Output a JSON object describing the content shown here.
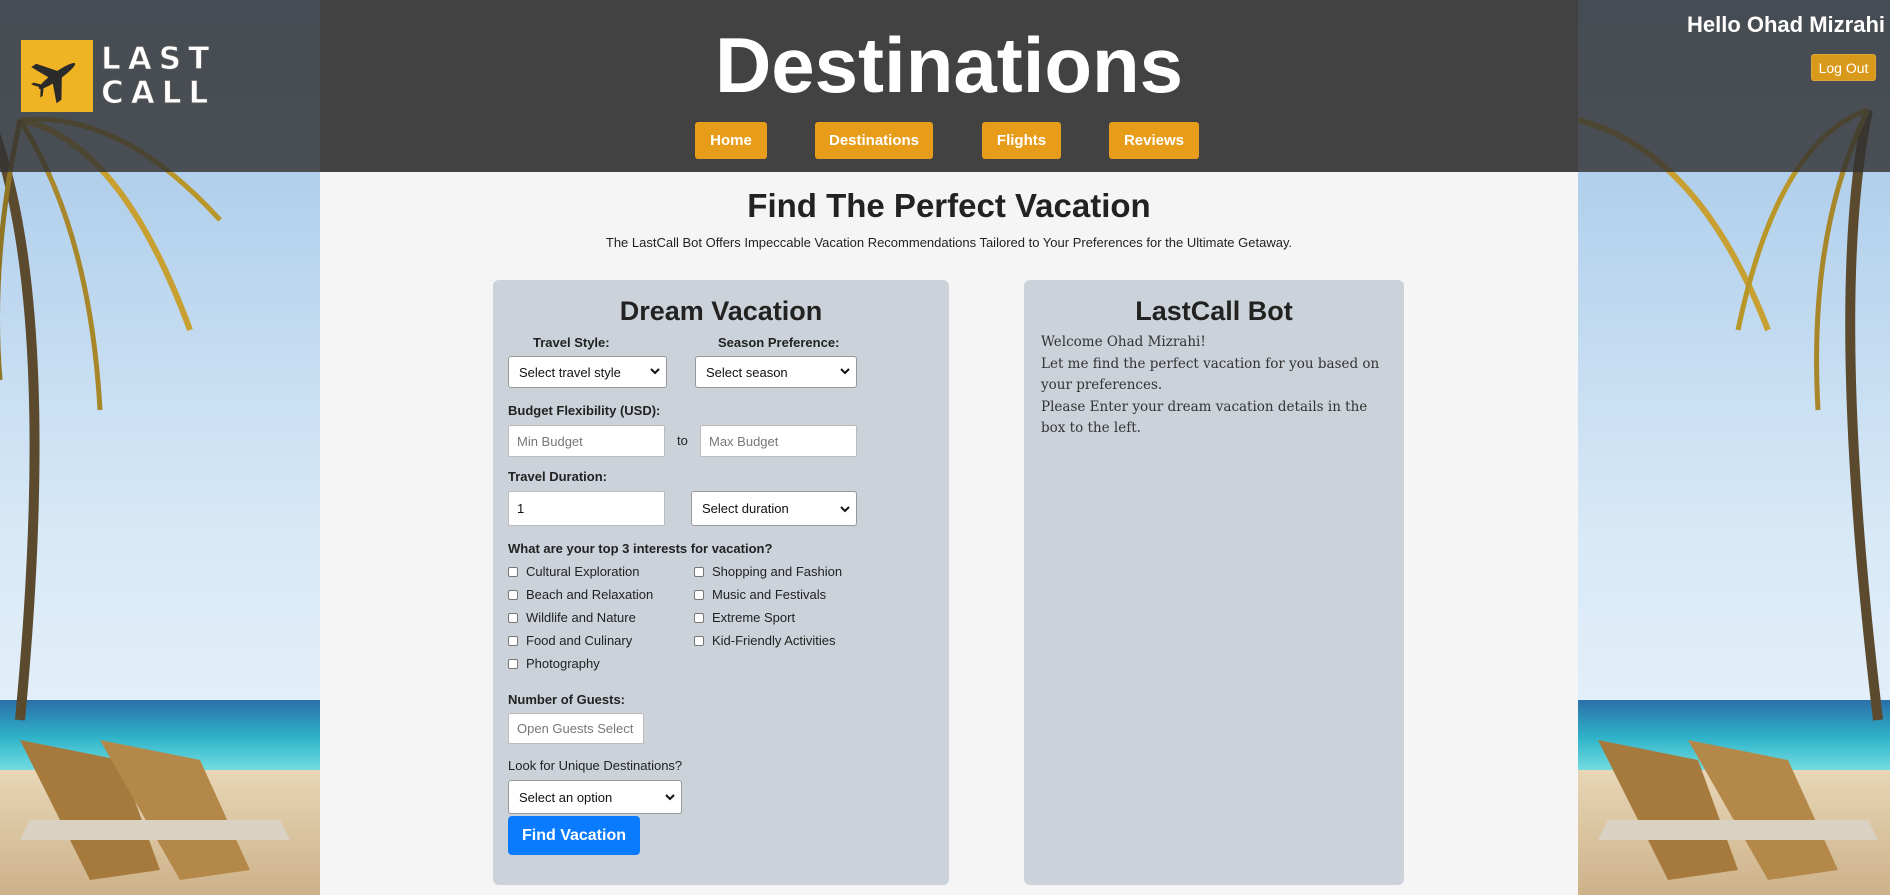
{
  "header": {
    "logo_text": "LAST CALL",
    "title": "Destinations",
    "greeting": "Hello Ohad Mizrahi",
    "logout_label": "Log Out",
    "nav": [
      {
        "label": "Home"
      },
      {
        "label": "Destinations"
      },
      {
        "label": "Flights"
      },
      {
        "label": "Reviews"
      }
    ]
  },
  "main": {
    "title": "Find The Perfect Vacation",
    "subtitle": "The LastCall Bot Offers Impeccable Vacation Recommendations Tailored to Your Preferences for the Ultimate Getaway."
  },
  "form": {
    "title": "Dream Vacation",
    "travel_style_label": "Travel Style:",
    "travel_style_value": "Select travel style",
    "season_label": "Season Preference:",
    "season_value": "Select season",
    "budget_label": "Budget Flexibility (USD):",
    "min_budget_placeholder": "Min Budget",
    "budget_to": "to",
    "max_budget_placeholder": "Max Budget",
    "duration_label": "Travel Duration:",
    "duration_value": "1",
    "duration_unit_value": "Select duration",
    "interests_label": "What are your top 3 interests for vacation?",
    "interests_left": [
      "Cultural Exploration",
      "Beach and Relaxation",
      "Wildlife and Nature",
      "Food and Culinary",
      "Photography"
    ],
    "interests_right": [
      "Shopping and Fashion",
      "Music and Festivals",
      "Extreme Sport",
      "Kid-Friendly Activities"
    ],
    "guests_label": "Number of Guests:",
    "guests_placeholder": "Open Guests Select",
    "unique_label": "Look for Unique Destinations?",
    "unique_value": "Select an option",
    "submit_label": "Find Vacation"
  },
  "bot": {
    "title": "LastCall Bot",
    "lines": [
      "Welcome Ohad Mizrahi!",
      "Let me find the perfect vacation for you based on your preferences.",
      "Please Enter your dream vacation details in the box to the left."
    ]
  },
  "colors": {
    "header_bg": "#434243",
    "nav_button": "#e79c1a",
    "card_bg": "#cbd2d9",
    "primary_button": "#0a7bff",
    "logo_yellow": "#f0b323"
  }
}
